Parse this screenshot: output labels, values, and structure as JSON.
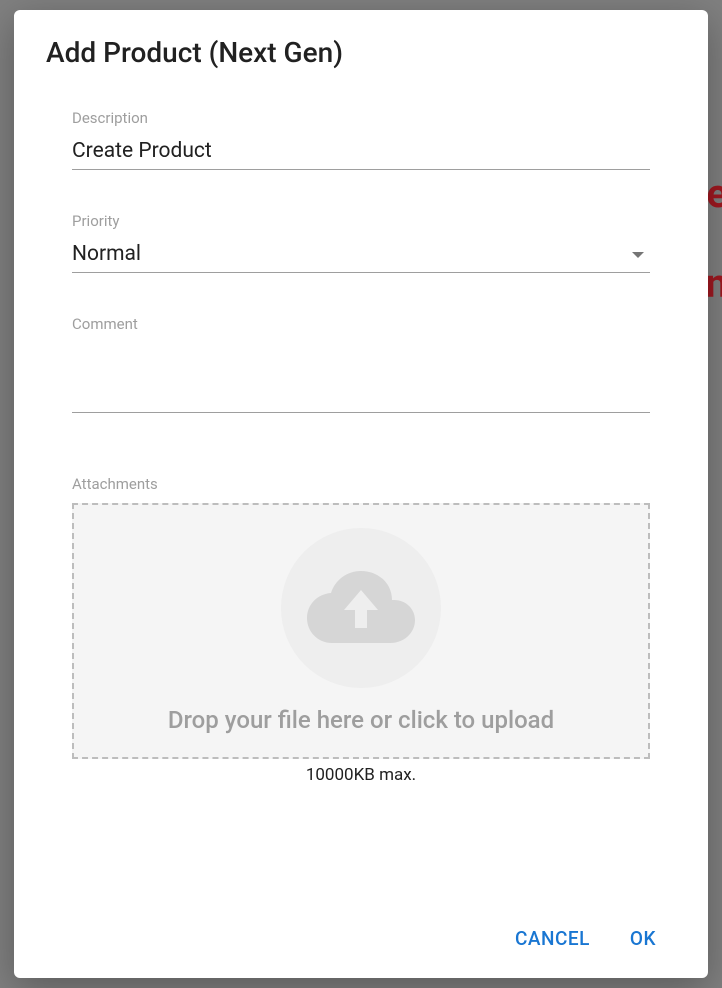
{
  "dialog": {
    "title": "Add Product (Next Gen)"
  },
  "fields": {
    "description": {
      "label": "Description",
      "value": "Create Product"
    },
    "priority": {
      "label": "Priority",
      "value": "Normal"
    },
    "comment": {
      "label": "Comment",
      "value": ""
    },
    "attachments": {
      "label": "Attachments",
      "dropText": "Drop your file here or click to upload",
      "maxText": "10000KB max."
    }
  },
  "actions": {
    "cancel": "CANCEL",
    "ok": "OK"
  }
}
